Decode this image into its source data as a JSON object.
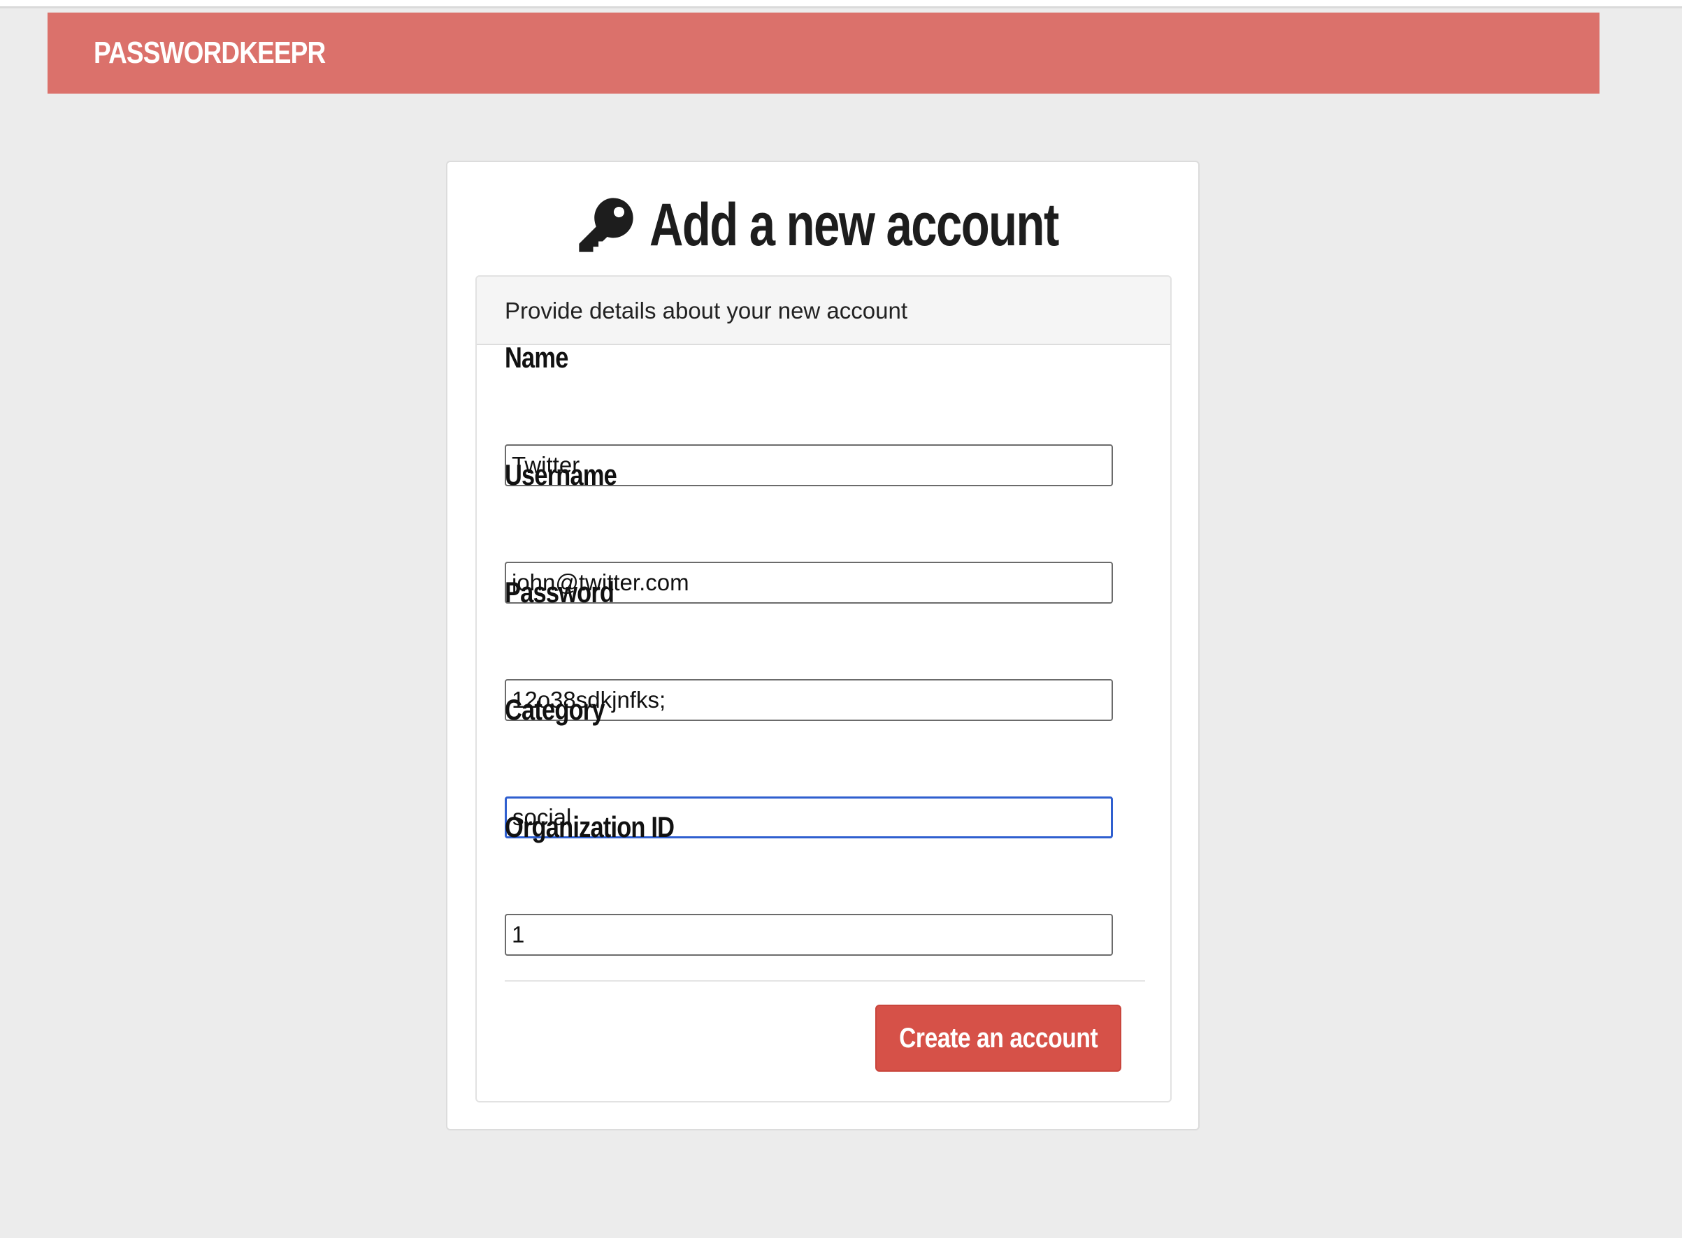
{
  "app": {
    "brand": "PASSWORDKEEPR"
  },
  "form": {
    "title": "Add a new account",
    "title_icon": "key-icon",
    "panel_heading": "Provide details about your new account",
    "fields": [
      {
        "label": "Name",
        "value": "Twitter"
      },
      {
        "label": "Username",
        "value": "john@twitter.com"
      },
      {
        "label": "Password",
        "value": "12o38sdkjnfks;"
      },
      {
        "label": "Category",
        "value": "social",
        "focused": true
      },
      {
        "label": "Organization ID",
        "value": "1"
      }
    ],
    "submit_label": "Create an account"
  },
  "colors": {
    "navbar": "#db716b",
    "button": "#d65148",
    "focus_ring": "#2f5fcf",
    "background": "#ececec"
  }
}
